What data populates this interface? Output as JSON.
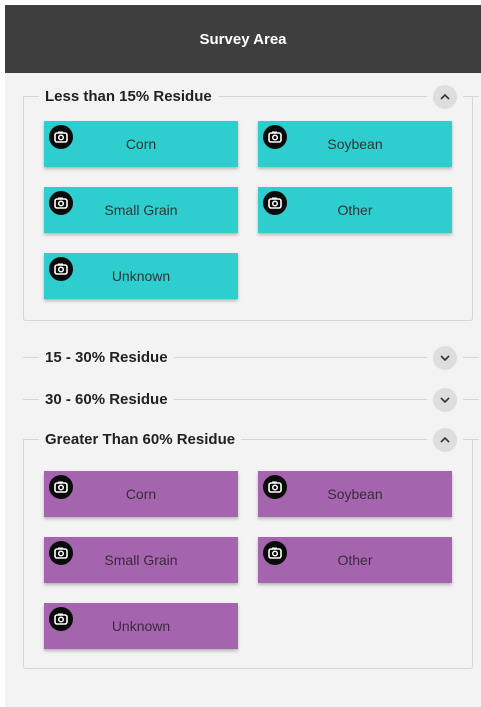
{
  "header": {
    "title": "Survey Area"
  },
  "sections": [
    {
      "title": "Less than 15% Residue",
      "expanded": true,
      "color": "#2ecece",
      "tiles": [
        "Corn",
        "Soybean",
        "Small Grain",
        "Other",
        "Unknown"
      ]
    },
    {
      "title": "15 - 30% Residue",
      "expanded": false
    },
    {
      "title": "30 - 60% Residue",
      "expanded": false
    },
    {
      "title": "Greater Than 60% Residue",
      "expanded": true,
      "color": "#a565ae",
      "tiles": [
        "Corn",
        "Soybean",
        "Small Grain",
        "Other",
        "Unknown"
      ]
    }
  ],
  "icons": {
    "tile": "camera-icon",
    "expanded_toggle": "chevron-up-icon",
    "collapsed_toggle": "chevron-down-icon"
  }
}
